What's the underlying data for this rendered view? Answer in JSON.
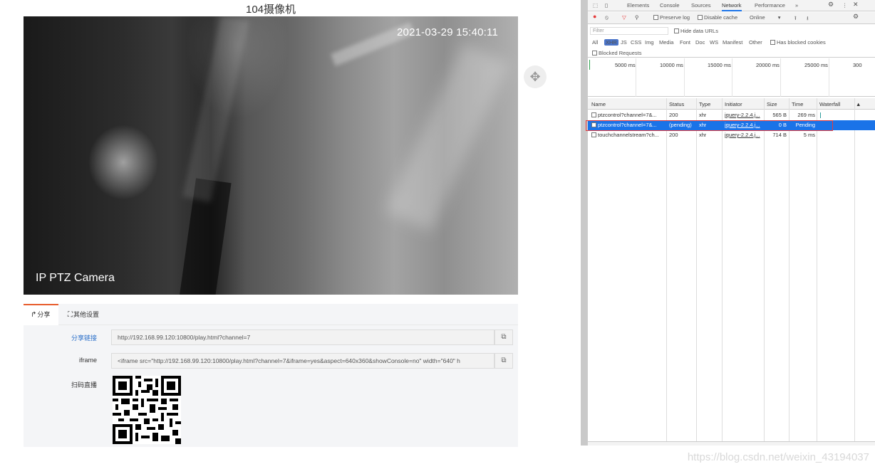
{
  "page": {
    "title": "104摄像机"
  },
  "video": {
    "timestamp": "2021-03-29 15:40:11",
    "label": "IP PTZ Camera"
  },
  "tabs": [
    {
      "icon": "↱",
      "label": "分享"
    },
    {
      "icon": "⛶",
      "label": "其他设置"
    }
  ],
  "share": {
    "link_label": "分享链接",
    "link_value": "http://192.168.99.120:10800/play.html?channel=7",
    "iframe_label": "iframe",
    "iframe_value": "<iframe src=\"http://192.168.99.120:10800/play.html?channel=7&iframe=yes&aspect=640x360&showConsole=no\" width=\"640\" h",
    "qr_label": "扫码直播"
  },
  "devtools": {
    "tabs": [
      "Elements",
      "Console",
      "Sources",
      "Network",
      "Performance"
    ],
    "active_tab": "Network",
    "more": "»",
    "toolbar": {
      "preserve_log": "Preserve log",
      "disable_cache": "Disable cache",
      "throttle": "Online"
    },
    "filter": {
      "placeholder": "Filter",
      "hide_data_urls": "Hide data URLs",
      "types": [
        "All",
        "XHR",
        "JS",
        "CSS",
        "Img",
        "Media",
        "Font",
        "Doc",
        "WS",
        "Manifest",
        "Other"
      ],
      "has_blocked_cookies": "Has blocked cookies",
      "blocked_requests": "Blocked Requests"
    },
    "timeline_ticks": [
      "5000 ms",
      "10000 ms",
      "15000 ms",
      "20000 ms",
      "25000 ms",
      "300"
    ],
    "columns": [
      "Name",
      "Status",
      "Type",
      "Initiator",
      "Size",
      "Time",
      "Waterfall"
    ],
    "requests": [
      {
        "name": "ptzcontrol?channel=7&...",
        "status": "200",
        "type": "xhr",
        "initiator": "jquery-2.2.4.j...",
        "size": "565 B",
        "time": "269 ms"
      },
      {
        "name": "ptzcontrol?channel=7&...",
        "status": "(pending)",
        "type": "xhr",
        "initiator": "jquery-2.2.4.j...",
        "size": "0 B",
        "time": "Pending"
      },
      {
        "name": "touchchannelstream?ch...",
        "status": "200",
        "type": "xhr",
        "initiator": "jquery-2.2.4.j...",
        "size": "714 B",
        "time": "5 ms"
      }
    ]
  },
  "watermark": "https://blog.csdn.net/weixin_43194037"
}
